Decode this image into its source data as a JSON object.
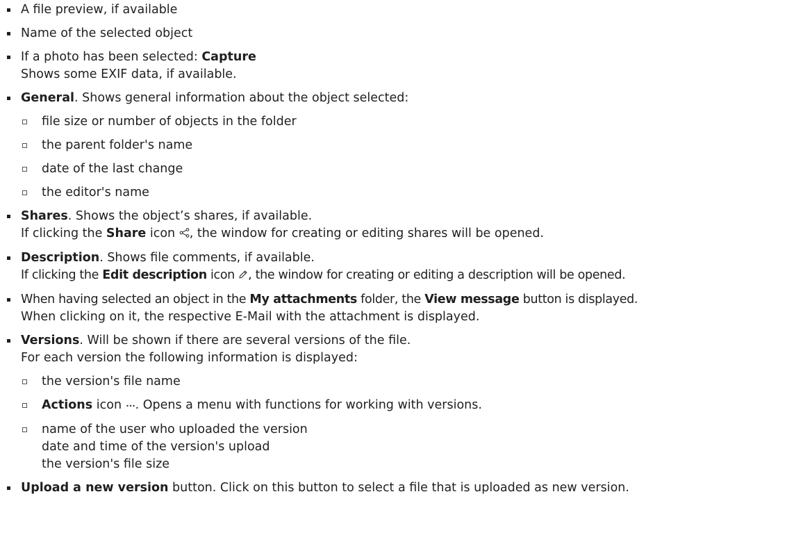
{
  "items": {
    "preview": "A file preview, if available",
    "name": "Name of the selected object",
    "capture_intro": "If a photo has been selected: ",
    "capture_bold": "Capture",
    "capture_desc": "Shows some EXIF data, if available.",
    "general_bold": "General",
    "general_text": ". Shows general information about the object selected:",
    "general_sub": [
      "file size or number of objects in the folder",
      "the parent folder's name",
      "date of the last change",
      "the editor's name"
    ],
    "shares_bold": "Shares",
    "shares_text": ". Shows the object’s shares, if available.",
    "shares_line2_a": "If clicking the ",
    "shares_line2_bold": "Share",
    "shares_line2_b": " icon ",
    "shares_line2_c": ", the window for creating or editing shares will be opened.",
    "desc_bold": "Description",
    "desc_text": ". Shows file comments, if available.",
    "desc_line2_a": "If clicking the ",
    "desc_line2_bold": "Edit description",
    "desc_line2_b": " icon ",
    "desc_line2_c": ", the window for creating or editing a description will be opened.",
    "att_a": "When having selected an object in the ",
    "att_bold1": "My attachments",
    "att_b": " folder, the ",
    "att_bold2": "View message",
    "att_c": " button is displayed.",
    "att_line2": "When clicking on it, the respective E-Mail with the attachment is displayed.",
    "versions_bold": "Versions",
    "versions_text": ". Will be shown if there are several versions of the file.",
    "versions_line2": "For each version the following information is displayed:",
    "versions_sub1": "the version's file name",
    "versions_sub2_bold": "Actions",
    "versions_sub2_a": " icon ",
    "versions_sub2_b": ". Opens a menu with functions for working with versions.",
    "versions_sub3_l1": "name of the user who uploaded the version",
    "versions_sub3_l2": "date and time of the version's upload",
    "versions_sub3_l3": "the version's file size",
    "upload_bold": "Upload a new version",
    "upload_text": " button. Click on this button to select a file that is uploaded as new version."
  },
  "icons": {
    "share": "share-icon",
    "edit": "pencil-icon",
    "actions": "ellipsis-icon"
  }
}
